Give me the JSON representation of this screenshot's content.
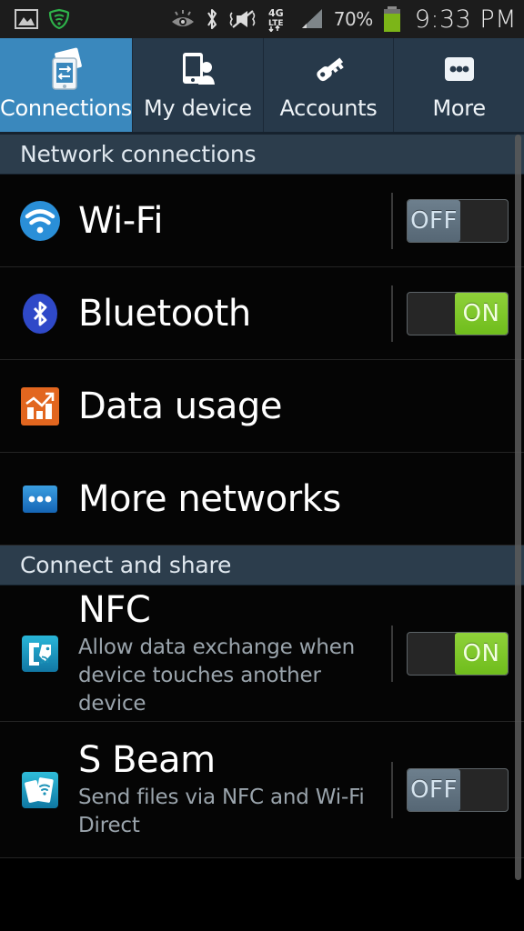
{
  "statusbar": {
    "time": "9:33 PM",
    "battery_percent": "70%",
    "icons_left": [
      "image-icon",
      "antivirus-shield-icon"
    ],
    "icons_right": [
      "smart-stay-eye-icon",
      "bluetooth-icon",
      "sound-mute-vibrate-icon",
      "4g-lte-icon",
      "signal-bars-icon",
      "battery-icon"
    ],
    "network_type": "4G LTE",
    "colors": {
      "battery_fill": "#7cb518",
      "bar_bg": "#1c1c1c"
    }
  },
  "tabs": [
    {
      "label": "Connections",
      "icon": "connections-icon",
      "active": true
    },
    {
      "label": "My device",
      "icon": "my-device-icon",
      "active": false
    },
    {
      "label": "Accounts",
      "icon": "key-icon",
      "active": false
    },
    {
      "label": "More",
      "icon": "more-dots-icon",
      "active": false
    }
  ],
  "sections": [
    {
      "header": "Network connections",
      "rows": [
        {
          "title": "Wi-Fi",
          "subtitle": "",
          "icon": "wifi-icon",
          "toggle": "OFF",
          "has_toggle": true
        },
        {
          "title": "Bluetooth",
          "subtitle": "",
          "icon": "bluetooth-icon",
          "toggle": "ON",
          "has_toggle": true
        },
        {
          "title": "Data usage",
          "subtitle": "",
          "icon": "data-usage-icon",
          "toggle": "",
          "has_toggle": false
        },
        {
          "title": "More networks",
          "subtitle": "",
          "icon": "more-networks-icon",
          "toggle": "",
          "has_toggle": false
        }
      ]
    },
    {
      "header": "Connect and share",
      "rows": [
        {
          "title": "NFC",
          "subtitle": "Allow data exchange when device touches another device",
          "icon": "nfc-icon",
          "toggle": "ON",
          "has_toggle": true
        },
        {
          "title": "S Beam",
          "subtitle": "Send files via NFC and Wi-Fi Direct",
          "icon": "s-beam-icon",
          "toggle": "OFF",
          "has_toggle": true
        }
      ]
    }
  ],
  "colors": {
    "tab_active": "#3a88bd",
    "tab_inactive": "#27394a",
    "section_header_bg": "#2c3d4c",
    "toggle_on": "#7dc81f",
    "toggle_off": "#5f717f",
    "list_bg": "#050505",
    "wifi_icon": "#2a8fd8",
    "bluetooth_icon": "#2f49c8",
    "data_usage_icon": "#e2661f",
    "more_networks_icon": "#1f7fd0",
    "nfc_icon": "#1f9fc0",
    "s_beam_icon": "#18a6c8"
  }
}
